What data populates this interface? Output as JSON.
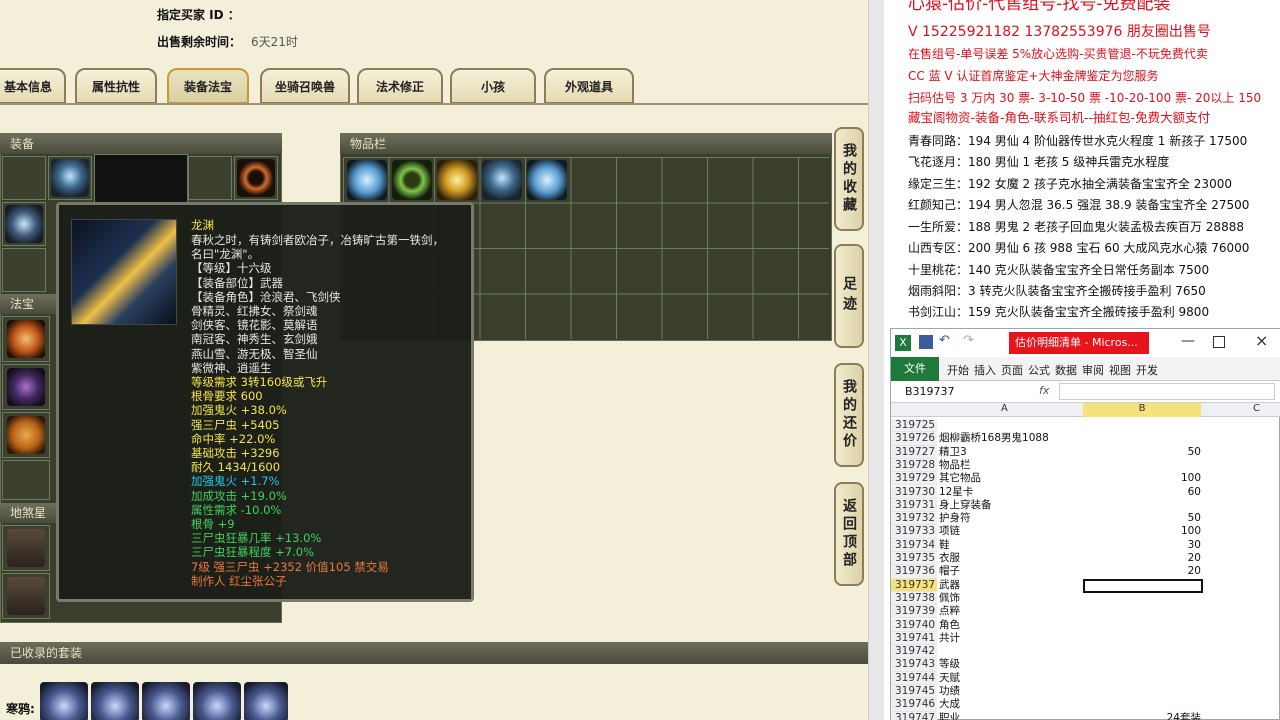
{
  "game": {
    "buyer_label": "指定买家 ID ：",
    "time_label": "出售剩余时间：",
    "time_value": "6天21时",
    "tabs": [
      "基本信息",
      "属性抗性",
      "装备法宝",
      "坐骑召唤兽",
      "法术修正",
      "小孩",
      "外观道具"
    ],
    "active_tab": 2,
    "equip_header": "装备",
    "inventory_header": "物品栏",
    "magic_header": "法宝",
    "tianji_header": "地煞星称",
    "suits_header": "已收录的套装",
    "suits_label": "寒鸦:",
    "side_buttons": [
      "我的收藏",
      "足迹",
      "我的还价",
      "返回顶部"
    ]
  },
  "tooltip": {
    "name": "龙渊",
    "lines": [
      {
        "t": "春秋之时，有铸剑者欧冶子，冶铸旷古第一铁剑，",
        "c": "w"
      },
      {
        "t": "名曰\"龙渊\"。",
        "c": "w"
      },
      {
        "t": "【等级】十六级",
        "c": "w"
      },
      {
        "t": "【装备部位】武器",
        "c": "w"
      },
      {
        "t": "【装备角色】沧浪君、飞剑侠",
        "c": "w"
      },
      {
        "t": "骨精灵、红拂女、祭剑魂",
        "c": "w"
      },
      {
        "t": "剑侠客、镜花影、莫解语",
        "c": "w"
      },
      {
        "t": "南冠客、神秀生、玄剑娥",
        "c": "w"
      },
      {
        "t": "燕山雪、游无极、智圣仙",
        "c": "w"
      },
      {
        "t": "紫微神、逍遥生",
        "c": "w"
      },
      {
        "t": "等级需求 3转160级或飞升",
        "c": "y"
      },
      {
        "t": "根骨要求 600",
        "c": "y"
      },
      {
        "t": "加强鬼火 +38.0%",
        "c": "y"
      },
      {
        "t": "强三尸虫 +5405",
        "c": "y"
      },
      {
        "t": "命中率 +22.0%",
        "c": "y"
      },
      {
        "t": "基础攻击 +3296",
        "c": "y"
      },
      {
        "t": "耐久 1434/1600",
        "c": "y"
      },
      {
        "t": "加强鬼火 +1.7%",
        "c": "cy"
      },
      {
        "t": "加成攻击 +19.0%",
        "c": "g2"
      },
      {
        "t": "属性需求 -10.0%",
        "c": "g2"
      },
      {
        "t": "根骨 +9",
        "c": "g2"
      },
      {
        "t": "三尸虫狂暴几率 +13.0%",
        "c": "g2"
      },
      {
        "t": "三尸虫狂暴程度 +7.0%",
        "c": "g2"
      },
      {
        "t": "7级 强三尸虫 +2352 价值105 禁交易",
        "c": "o"
      },
      {
        "t": "制作人 红尘张公子",
        "c": "o"
      }
    ]
  },
  "ad": {
    "lines": [
      {
        "t": "心猿-估价-代售组号-找号-免费配装",
        "c": "red"
      },
      {
        "t": "V 15225921182    13782553976 朋友圈出售号",
        "c": "red"
      },
      {
        "t": "在售组号-单号误差 5%放心选购-买贵管退-不玩免费代卖",
        "c": "red"
      },
      {
        "t": "CC 蓝 V 认证首席鉴定+大神金牌鉴定为您服务",
        "c": "red"
      },
      {
        "t": "扫码估号 3 万内 30 票- 3-10-50 票  -10-20-100 票- 20以上 150",
        "c": "red"
      },
      {
        "t": "藏宝阁物资-装备-角色-联系司机--抽红包-免费大额支付",
        "c": "red"
      },
      {
        "t": "青春同路：194 男仙 4 阶仙器传世水克火程度 1 新孩子 17500",
        "c": "blk"
      },
      {
        "t": "飞花逐月：180 男仙 1 老孩 5 级神兵雷克水程度",
        "c": "blk"
      },
      {
        "t": "缘定三生：192 女魔 2 孩子克水抽全满装备宝宝齐全 23000",
        "c": "blk"
      },
      {
        "t": "红颜知己：194 男人忽混 36.5 强混 38.9 装备宝宝齐全 27500",
        "c": "blk"
      },
      {
        "t": "一生所爱：188 男鬼 2 老孩子回血鬼火装孟极去疾百万 28888",
        "c": "blk"
      },
      {
        "t": "山西专区：200 男仙 6 孩 988 宝石 60 大成风克水心猿 76000",
        "c": "blk"
      },
      {
        "t": "十里桃花：140 克火队装备宝宝齐全日常任务副本 7500",
        "c": "blk"
      },
      {
        "t": "烟雨斜阳：3 转克火队装备宝宝齐全搬砖接手盈利 7650",
        "c": "blk"
      },
      {
        "t": "书剑江山：159 克火队装备宝宝齐全搬砖接手盈利 9800",
        "c": "blk"
      }
    ]
  },
  "excel": {
    "title": "估价明细清单 - Micros...",
    "menu": [
      "文件",
      "开始",
      "插入",
      "页面",
      "公式",
      "数据",
      "审阅",
      "视图",
      "开发"
    ],
    "name_box": "B319737",
    "fx": "fx",
    "col_a": "A",
    "col_b": "B",
    "col_c": "C",
    "rows": [
      {
        "n": "319725",
        "a": "",
        "b": ""
      },
      {
        "n": "319726",
        "a": "烟柳霸桥168男鬼1088",
        "b": ""
      },
      {
        "n": "319727",
        "a": "精卫3",
        "b": "50"
      },
      {
        "n": "319728",
        "a": "物品栏",
        "b": ""
      },
      {
        "n": "319729",
        "a": "其它物品",
        "b": "100"
      },
      {
        "n": "319730",
        "a": "12星卡",
        "b": "60"
      },
      {
        "n": "319731",
        "a": "身上穿装备",
        "b": ""
      },
      {
        "n": "319732",
        "a": "护身符",
        "b": "50"
      },
      {
        "n": "319733",
        "a": "项链",
        "b": "100"
      },
      {
        "n": "319734",
        "a": "鞋",
        "b": "30"
      },
      {
        "n": "319735",
        "a": "衣服",
        "b": "20"
      },
      {
        "n": "319736",
        "a": "帽子",
        "b": "20"
      },
      {
        "n": "319737",
        "a": "武器",
        "b": ""
      },
      {
        "n": "319738",
        "a": "佩饰",
        "b": ""
      },
      {
        "n": "319739",
        "a": "点粹",
        "b": ""
      },
      {
        "n": "319740",
        "a": "角色",
        "b": ""
      },
      {
        "n": "319741",
        "a": "共计",
        "b": ""
      },
      {
        "n": "319742",
        "a": "",
        "b": ""
      },
      {
        "n": "319743",
        "a": "等级",
        "b": ""
      },
      {
        "n": "319744",
        "a": "天赋",
        "b": ""
      },
      {
        "n": "319745",
        "a": "功绩",
        "b": ""
      },
      {
        "n": "319746",
        "a": "大成",
        "b": ""
      },
      {
        "n": "319747",
        "a": "职业",
        "b": "24套装"
      }
    ]
  }
}
